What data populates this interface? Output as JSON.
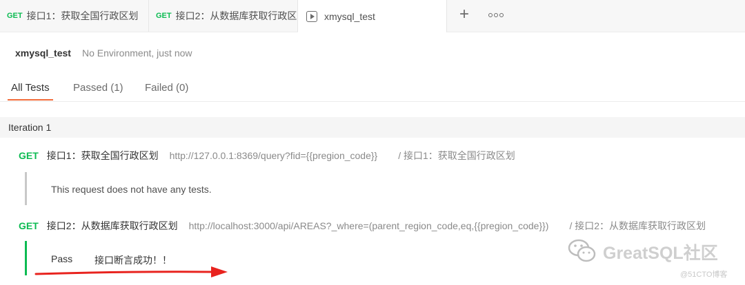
{
  "tabs": [
    {
      "method": "GET",
      "label": "接口1：获取全国行政区划"
    },
    {
      "method": "GET",
      "label": "接口2：从数据库获取行政区"
    },
    {
      "label": "xmysql_test"
    }
  ],
  "run": {
    "title": "xmysql_test",
    "meta": "No Environment, just now"
  },
  "filters": {
    "all": "All Tests",
    "passed": "Passed (1)",
    "failed": "Failed (0)"
  },
  "iteration": "Iteration 1",
  "requests": [
    {
      "method": "GET",
      "name": "接口1：获取全国行政区划",
      "url": "http://127.0.0.1:8369/query?fid={{pregion_code}}",
      "path": "/ 接口1：获取全国行政区划",
      "message": "This request does not have any tests."
    },
    {
      "method": "GET",
      "name": "接口2：从数据库获取行政区划",
      "url": "http://localhost:3000/api/AREAS?_where=(parent_region_code,eq,{{pregion_code}})",
      "path": "/ 接口2：从数据库获取行政区划",
      "result": "Pass",
      "message": "接口断言成功！！"
    }
  ],
  "watermark": {
    "text": "GreatSQL社区",
    "sub": "@51CTO博客"
  },
  "colors": {
    "get": "#0cbb52",
    "accent": "#f26b3a",
    "pass_bar": "#0cbb52",
    "arrow": "#e8231e"
  }
}
